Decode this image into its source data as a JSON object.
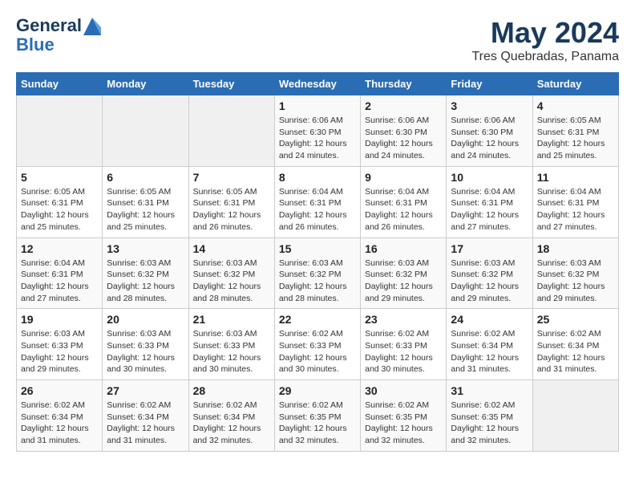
{
  "logo": {
    "line1": "General",
    "line2": "Blue"
  },
  "title": "May 2024",
  "location": "Tres Quebradas, Panama",
  "days_header": [
    "Sunday",
    "Monday",
    "Tuesday",
    "Wednesday",
    "Thursday",
    "Friday",
    "Saturday"
  ],
  "weeks": [
    [
      {
        "day": "",
        "info": ""
      },
      {
        "day": "",
        "info": ""
      },
      {
        "day": "",
        "info": ""
      },
      {
        "day": "1",
        "info": "Sunrise: 6:06 AM\nSunset: 6:30 PM\nDaylight: 12 hours\nand 24 minutes."
      },
      {
        "day": "2",
        "info": "Sunrise: 6:06 AM\nSunset: 6:30 PM\nDaylight: 12 hours\nand 24 minutes."
      },
      {
        "day": "3",
        "info": "Sunrise: 6:06 AM\nSunset: 6:30 PM\nDaylight: 12 hours\nand 24 minutes."
      },
      {
        "day": "4",
        "info": "Sunrise: 6:05 AM\nSunset: 6:31 PM\nDaylight: 12 hours\nand 25 minutes."
      }
    ],
    [
      {
        "day": "5",
        "info": "Sunrise: 6:05 AM\nSunset: 6:31 PM\nDaylight: 12 hours\nand 25 minutes."
      },
      {
        "day": "6",
        "info": "Sunrise: 6:05 AM\nSunset: 6:31 PM\nDaylight: 12 hours\nand 25 minutes."
      },
      {
        "day": "7",
        "info": "Sunrise: 6:05 AM\nSunset: 6:31 PM\nDaylight: 12 hours\nand 26 minutes."
      },
      {
        "day": "8",
        "info": "Sunrise: 6:04 AM\nSunset: 6:31 PM\nDaylight: 12 hours\nand 26 minutes."
      },
      {
        "day": "9",
        "info": "Sunrise: 6:04 AM\nSunset: 6:31 PM\nDaylight: 12 hours\nand 26 minutes."
      },
      {
        "day": "10",
        "info": "Sunrise: 6:04 AM\nSunset: 6:31 PM\nDaylight: 12 hours\nand 27 minutes."
      },
      {
        "day": "11",
        "info": "Sunrise: 6:04 AM\nSunset: 6:31 PM\nDaylight: 12 hours\nand 27 minutes."
      }
    ],
    [
      {
        "day": "12",
        "info": "Sunrise: 6:04 AM\nSunset: 6:31 PM\nDaylight: 12 hours\nand 27 minutes."
      },
      {
        "day": "13",
        "info": "Sunrise: 6:03 AM\nSunset: 6:32 PM\nDaylight: 12 hours\nand 28 minutes."
      },
      {
        "day": "14",
        "info": "Sunrise: 6:03 AM\nSunset: 6:32 PM\nDaylight: 12 hours\nand 28 minutes."
      },
      {
        "day": "15",
        "info": "Sunrise: 6:03 AM\nSunset: 6:32 PM\nDaylight: 12 hours\nand 28 minutes."
      },
      {
        "day": "16",
        "info": "Sunrise: 6:03 AM\nSunset: 6:32 PM\nDaylight: 12 hours\nand 29 minutes."
      },
      {
        "day": "17",
        "info": "Sunrise: 6:03 AM\nSunset: 6:32 PM\nDaylight: 12 hours\nand 29 minutes."
      },
      {
        "day": "18",
        "info": "Sunrise: 6:03 AM\nSunset: 6:32 PM\nDaylight: 12 hours\nand 29 minutes."
      }
    ],
    [
      {
        "day": "19",
        "info": "Sunrise: 6:03 AM\nSunset: 6:33 PM\nDaylight: 12 hours\nand 29 minutes."
      },
      {
        "day": "20",
        "info": "Sunrise: 6:03 AM\nSunset: 6:33 PM\nDaylight: 12 hours\nand 30 minutes."
      },
      {
        "day": "21",
        "info": "Sunrise: 6:03 AM\nSunset: 6:33 PM\nDaylight: 12 hours\nand 30 minutes."
      },
      {
        "day": "22",
        "info": "Sunrise: 6:02 AM\nSunset: 6:33 PM\nDaylight: 12 hours\nand 30 minutes."
      },
      {
        "day": "23",
        "info": "Sunrise: 6:02 AM\nSunset: 6:33 PM\nDaylight: 12 hours\nand 30 minutes."
      },
      {
        "day": "24",
        "info": "Sunrise: 6:02 AM\nSunset: 6:34 PM\nDaylight: 12 hours\nand 31 minutes."
      },
      {
        "day": "25",
        "info": "Sunrise: 6:02 AM\nSunset: 6:34 PM\nDaylight: 12 hours\nand 31 minutes."
      }
    ],
    [
      {
        "day": "26",
        "info": "Sunrise: 6:02 AM\nSunset: 6:34 PM\nDaylight: 12 hours\nand 31 minutes."
      },
      {
        "day": "27",
        "info": "Sunrise: 6:02 AM\nSunset: 6:34 PM\nDaylight: 12 hours\nand 31 minutes."
      },
      {
        "day": "28",
        "info": "Sunrise: 6:02 AM\nSunset: 6:34 PM\nDaylight: 12 hours\nand 32 minutes."
      },
      {
        "day": "29",
        "info": "Sunrise: 6:02 AM\nSunset: 6:35 PM\nDaylight: 12 hours\nand 32 minutes."
      },
      {
        "day": "30",
        "info": "Sunrise: 6:02 AM\nSunset: 6:35 PM\nDaylight: 12 hours\nand 32 minutes."
      },
      {
        "day": "31",
        "info": "Sunrise: 6:02 AM\nSunset: 6:35 PM\nDaylight: 12 hours\nand 32 minutes."
      },
      {
        "day": "",
        "info": ""
      }
    ]
  ]
}
